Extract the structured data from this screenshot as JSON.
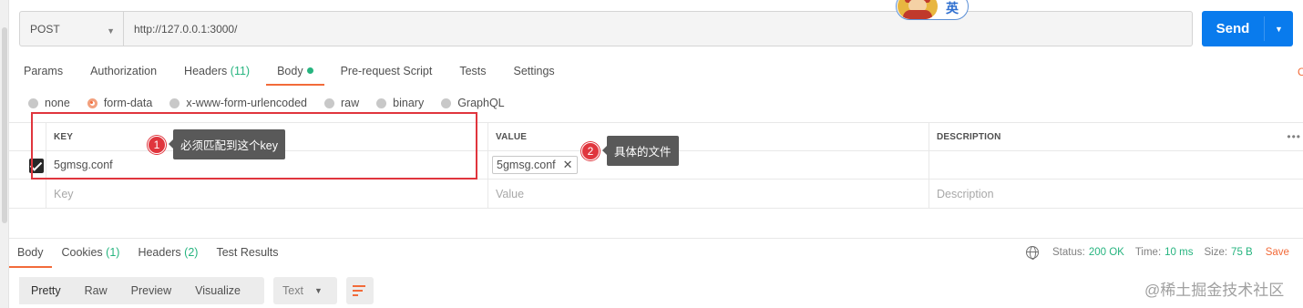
{
  "request": {
    "method": "POST",
    "url": "http://127.0.0.1:3000/",
    "send_label": "Send"
  },
  "avatar": {
    "badge": "英"
  },
  "request_tabs": [
    {
      "label": "Params"
    },
    {
      "label": "Authorization"
    },
    {
      "label": "Headers",
      "count": "(11)"
    },
    {
      "label": "Body",
      "active": true
    },
    {
      "label": "Pre-request Script"
    },
    {
      "label": "Tests"
    },
    {
      "label": "Settings"
    }
  ],
  "cookies_edge": "C",
  "body_types": [
    {
      "label": "none",
      "selected": false
    },
    {
      "label": "form-data",
      "selected": true
    },
    {
      "label": "x-www-form-urlencoded",
      "selected": false
    },
    {
      "label": "raw",
      "selected": false
    },
    {
      "label": "binary",
      "selected": false
    },
    {
      "label": "GraphQL",
      "selected": false
    }
  ],
  "table": {
    "headers": {
      "key": "KEY",
      "value": "VALUE",
      "description": "DESCRIPTION",
      "more": "•••"
    },
    "row": {
      "key": "5gmsg.conf",
      "value": "5gmsg.conf",
      "description": ""
    },
    "placeholders": {
      "key": "Key",
      "value": "Value",
      "description": "Description"
    }
  },
  "annotations": [
    {
      "num": "1",
      "text": "必须匹配到这个key"
    },
    {
      "num": "2",
      "text": "具体的文件"
    }
  ],
  "response_tabs": [
    {
      "label": "Body",
      "active": true
    },
    {
      "label": "Cookies",
      "count": "(1)"
    },
    {
      "label": "Headers",
      "count": "(2)"
    },
    {
      "label": "Test Results"
    }
  ],
  "status": {
    "status_label": "Status:",
    "status_value": "200 OK",
    "time_label": "Time:",
    "time_value": "10 ms",
    "size_label": "Size:",
    "size_value": "75 B",
    "save_edge": "Save"
  },
  "view_modes": [
    "Pretty",
    "Raw",
    "Preview",
    "Visualize"
  ],
  "format_select": "Text",
  "watermark": "@稀土掘金技术社区",
  "colors": {
    "accent": "#f26b3a",
    "send": "#097bed",
    "success": "#26b47f",
    "annotation": "#e0353d"
  }
}
